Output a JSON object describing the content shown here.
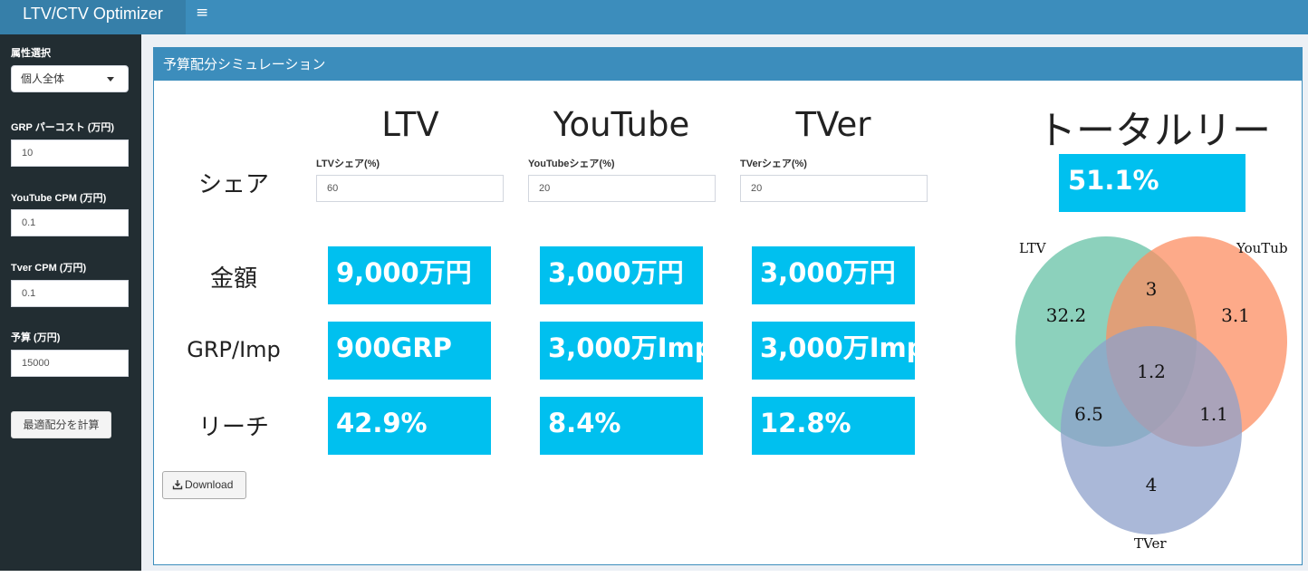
{
  "app": {
    "title": "LTV/CTV Optimizer",
    "menu_icon": "≡"
  },
  "sidebar": {
    "segment_label": "属性選択",
    "segment_value": "個人全体",
    "grp_cost_label": "GRP パーコスト (万円)",
    "grp_cost_value": "10",
    "youtube_cpm_label": "YouTube CPM (万円)",
    "youtube_cpm_value": "0.1",
    "tver_cpm_label": "Tver CPM (万円)",
    "tver_cpm_value": "0.1",
    "budget_label": "予算 (万円)",
    "budget_value": "15000",
    "calc_button": "最適配分を計算"
  },
  "main": {
    "box_title": "予算配分シミュレーション",
    "columns": [
      "LTV",
      "YouTube",
      "TVer"
    ],
    "rows": {
      "share": "シェア",
      "amount": "金額",
      "grp": "GRP/Imp",
      "reach": "リーチ"
    },
    "share_inputs": [
      {
        "label": "LTVシェア(%)",
        "value": "60"
      },
      {
        "label": "YouTubeシェア(%)",
        "value": "20"
      },
      {
        "label": "TVerシェア(%)",
        "value": "20"
      }
    ],
    "amount": [
      "9,000万円",
      "3,000万円",
      "3,000万円"
    ],
    "grp": [
      "900GRP",
      "3,000万Imp",
      "3,000万Imp"
    ],
    "reach": [
      "42.9%",
      "8.4%",
      "12.8%"
    ],
    "download_label": "Download",
    "total_title": "トータルリーチ",
    "total_value": "51.1%"
  },
  "venn": {
    "labels": {
      "a": "LTV",
      "b": "YouTub",
      "c": "TVer"
    },
    "values": {
      "only_ltv": "32.2",
      "only_youtube": "3.1",
      "only_tver": "4",
      "ltv_youtube": "3",
      "ltv_tver": "6.5",
      "youtube_tver": "1.1",
      "all": "1.2"
    },
    "colors": {
      "ltv": "#66c2a5",
      "youtube": "#fc8d62",
      "tver": "#8da0cb"
    }
  },
  "colors": {
    "header": "#3c8dbc",
    "logo": "#367fa9",
    "sidebar": "#222d32",
    "value_box": "#00c0ef"
  }
}
